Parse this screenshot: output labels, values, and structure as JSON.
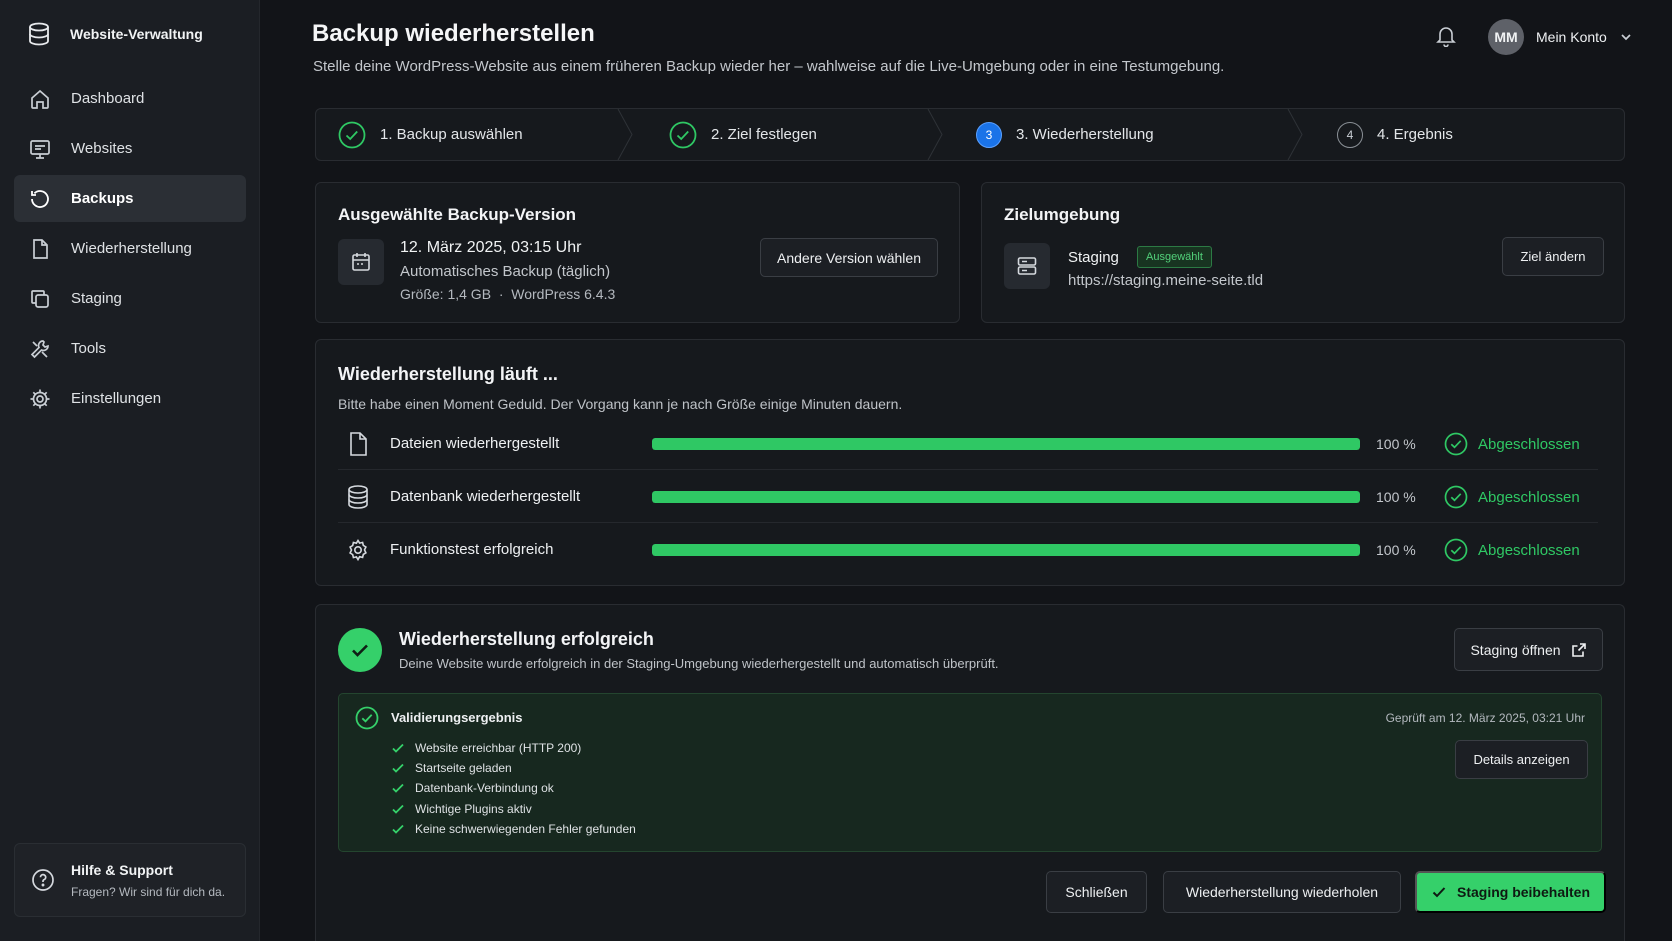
{
  "app": {
    "title": "Website-Verwaltung"
  },
  "sidebar": {
    "items": [
      {
        "label": "Dashboard",
        "icon": "home-icon"
      },
      {
        "label": "Websites",
        "icon": "monitor-icon"
      },
      {
        "label": "Backups",
        "icon": "history-icon",
        "active": true
      },
      {
        "label": "Wiederherstellung",
        "icon": "file-icon"
      },
      {
        "label": "Staging",
        "icon": "copy-icon"
      },
      {
        "label": "Tools",
        "icon": "tools-icon"
      },
      {
        "label": "Einstellungen",
        "icon": "gear-icon"
      }
    ],
    "help": {
      "title": "Hilfe & Support",
      "subtitle": "Fragen? Wir sind für dich da."
    }
  },
  "header": {
    "title": "Backup wiederherstellen",
    "subtitle": "Stelle deine WordPress-Website aus einem früheren Backup wieder her – wahlweise auf die Live-Umgebung oder in eine Testumgebung.",
    "account": {
      "initials": "MM",
      "label": "Mein Konto"
    }
  },
  "stepper": {
    "steps": [
      {
        "label": "1. Backup auswählen",
        "state": "done"
      },
      {
        "label": "2. Ziel festlegen",
        "state": "done"
      },
      {
        "num": "3",
        "label": "3. Wiederherstellung",
        "state": "active"
      },
      {
        "num": "4",
        "label": "4. Ergebnis",
        "state": "pending"
      }
    ]
  },
  "backup": {
    "title": "Ausgewählte Backup-Version",
    "date": "12. März 2025, 03:15 Uhr",
    "type": "Automatisches Backup (täglich)",
    "meta": "Größe: 1,4 GB  ·  WordPress 6.4.3",
    "button": "Andere Version wählen"
  },
  "target": {
    "title": "Zielumgebung",
    "name": "Staging",
    "badge": "Ausgewählt",
    "url": "https://staging.meine-seite.tld",
    "button": "Ziel ändern"
  },
  "progress": {
    "title": "Wiederherstellung läuft ...",
    "subtitle": "Bitte habe einen Moment Geduld. Der Vorgang kann je nach Größe einige Minuten dauern.",
    "rows": [
      {
        "label": "Dateien wiederhergestellt",
        "icon": "file-icon",
        "percent": 100,
        "percent_text": "100 %",
        "status": "Abgeschlossen"
      },
      {
        "label": "Datenbank wiederhergestellt",
        "icon": "database-icon",
        "percent": 100,
        "percent_text": "100 %",
        "status": "Abgeschlossen"
      },
      {
        "label": "Funktionstest erfolgreich",
        "icon": "gear-icon",
        "percent": 100,
        "percent_text": "100 %",
        "status": "Abgeschlossen"
      }
    ]
  },
  "result": {
    "title": "Wiederherstellung erfolgreich",
    "subtitle": "Deine Website wurde erfolgreich in der Staging-Umgebung wiederhergestellt und automatisch überprüft.",
    "open_button": "Staging öffnen",
    "validation": {
      "title": "Validierungsergebnis",
      "checked": "Geprüft am 12. März 2025, 03:21 Uhr",
      "details_button": "Details anzeigen",
      "items": [
        "Website erreichbar (HTTP 200)",
        "Startseite geladen",
        "Datenbank-Verbindung ok",
        "Wichtige Plugins aktiv",
        "Keine schwerwiegenden Fehler gefunden"
      ]
    }
  },
  "actions": {
    "close": "Schließen",
    "retry": "Wiederherstellung wiederholen",
    "keep": "Staging beibehalten"
  },
  "colors": {
    "accent": "#35d06a",
    "active_step": "#1a73e8",
    "background": "#121418"
  }
}
